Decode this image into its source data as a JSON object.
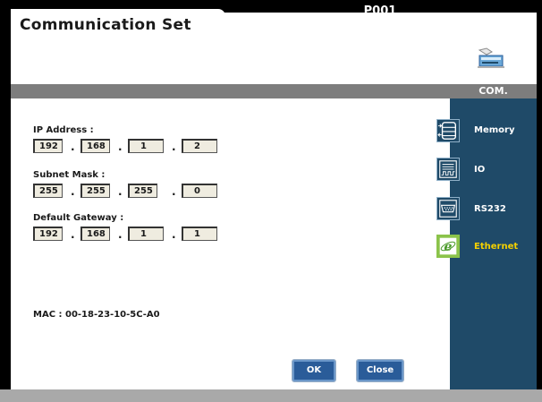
{
  "window": {
    "title": "Communication Set",
    "screen_id": "P001"
  },
  "section": {
    "label": "COM."
  },
  "ip_address": {
    "label": "IP Address :",
    "octets": [
      "192",
      "168",
      "1",
      "2"
    ]
  },
  "subnet_mask": {
    "label": "Subnet Mask :",
    "octets": [
      "255",
      "255",
      "255",
      "0"
    ]
  },
  "default_gateway": {
    "label": "Default Gateway :",
    "octets": [
      "192",
      "168",
      "1",
      "1"
    ]
  },
  "separator": ".",
  "mac": {
    "text": "MAC : 00-18-23-10-5C-A0"
  },
  "buttons": {
    "ok": "OK",
    "close": "Close"
  },
  "sidebar": {
    "items": [
      {
        "label": "Memory",
        "icon": "memory-icon",
        "active": false
      },
      {
        "label": "IO",
        "icon": "io-icon",
        "active": false
      },
      {
        "label": "RS232",
        "icon": "rs232-icon",
        "active": false
      },
      {
        "label": "Ethernet",
        "icon": "ethernet-icon",
        "active": true
      }
    ]
  },
  "colors": {
    "sidebar_bg": "#1f4a68",
    "active_label": "#f4d000",
    "button_bg": "#2a5c99",
    "field_bg": "#efece0"
  }
}
